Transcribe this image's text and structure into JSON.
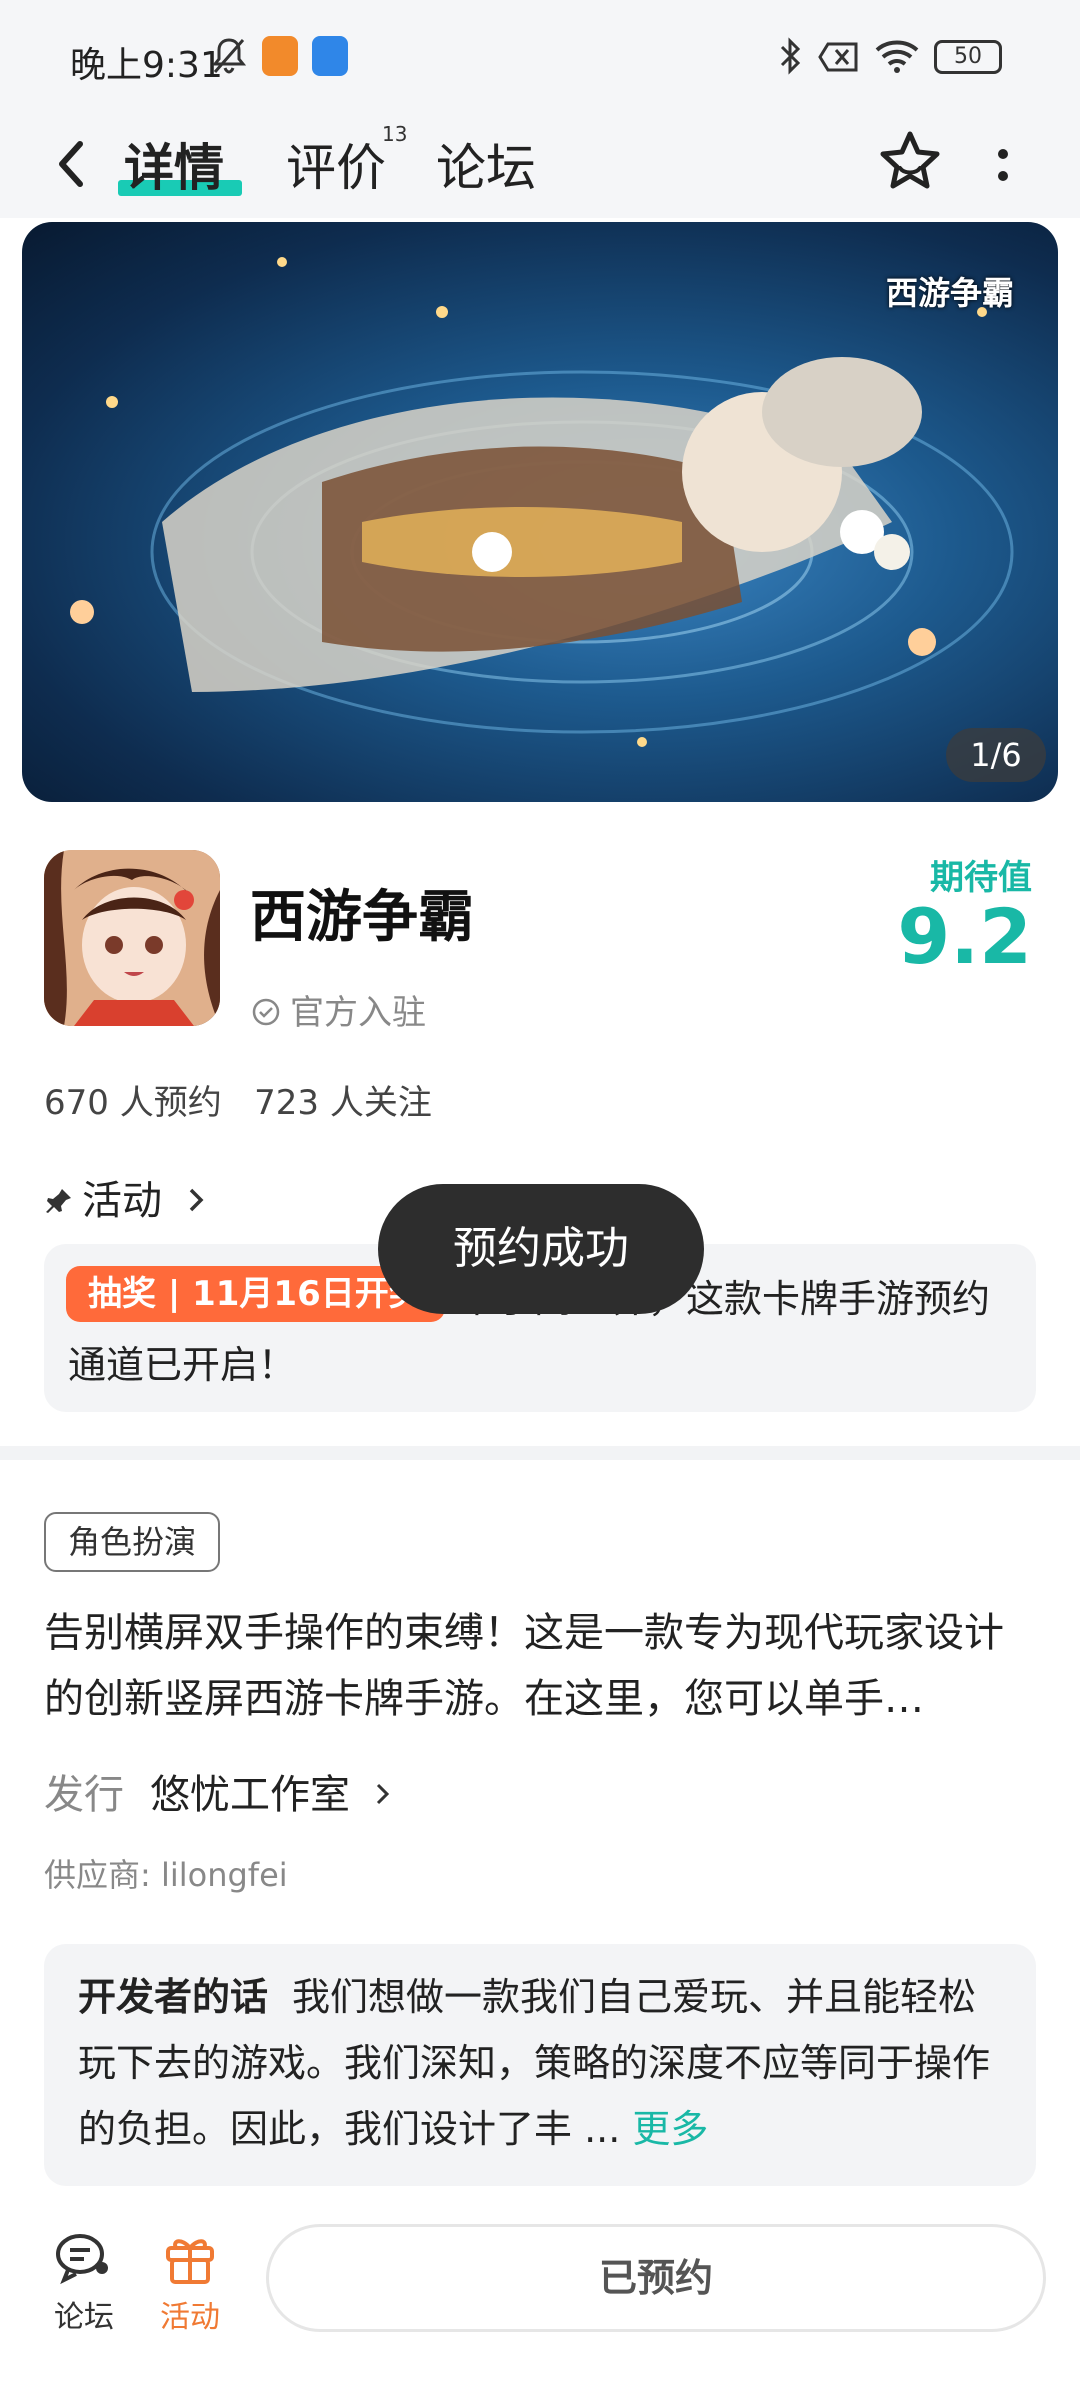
{
  "status_bar": {
    "time": "晚上9:31",
    "battery": "50"
  },
  "nav": {
    "tabs": [
      {
        "label": "详情"
      },
      {
        "label": "评价"
      },
      {
        "label": "论坛"
      }
    ],
    "review_count": "13"
  },
  "banner": {
    "logo_text": "西游争霸",
    "counter": "1/6"
  },
  "game": {
    "title": "西游争霸",
    "official_label": "官方入驻",
    "score_label": "期待值",
    "score": "9.2",
    "counts": "670 人预约   723 人关注"
  },
  "activity": {
    "title": "活动",
    "tag": "抽奖 | 11月16日开奖",
    "text": "单手闯三界，这款卡牌手游预约通道已开启！"
  },
  "toast": "预约成功",
  "genre": "角色扮演",
  "description": "告别横屏双手操作的束缚！这是一款专为现代玩家设计的创新竖屏西游卡牌手游。在这里，您可以单手…",
  "publisher": {
    "label": "发行",
    "name": "悠忧工作室"
  },
  "supplier": "供应商: lilongfei",
  "developer_words": {
    "label": "开发者的话",
    "text": "我们想做一款我们自己爱玩、并且能轻松玩下去的游戏。我们深知，策略的深度不应等同于操作的负担。因此，我们设计了丰 ... ",
    "more": "更多"
  },
  "bottom_bar": {
    "forum_label": "论坛",
    "activity_label": "活动",
    "reserved_label": "已预约"
  },
  "colors": {
    "accent": "#19b8a6",
    "tag": "#ff6a3a",
    "activity_tab": "#f07a34"
  }
}
